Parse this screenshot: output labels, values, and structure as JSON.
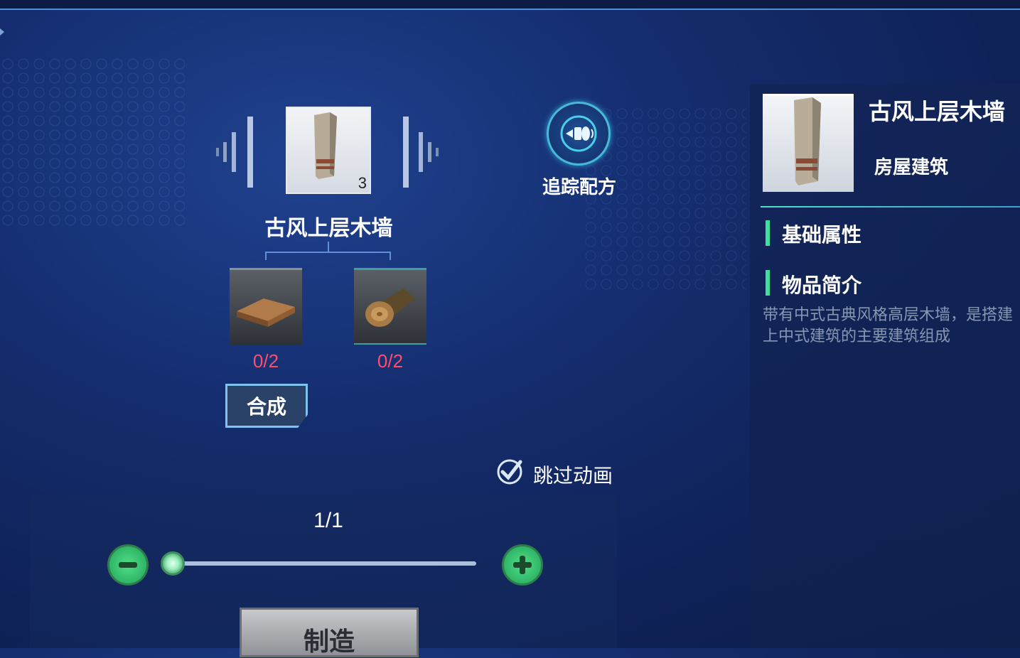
{
  "product": {
    "name": "古风上层木墙",
    "count": "3"
  },
  "materials": [
    {
      "name": "wood-plank",
      "progress": "0/2"
    },
    {
      "name": "wood-log",
      "progress": "0/2"
    }
  ],
  "buttons": {
    "synthesize": "合成",
    "track_recipe": "追踪配方",
    "make": "制造"
  },
  "skip_animation": {
    "label": "跳过动画",
    "checked": true
  },
  "quantity": {
    "ratio": "1/1",
    "current": 1,
    "max": 1
  },
  "info_panel": {
    "name": "古风上层木墙",
    "category": "房屋建筑",
    "sections": {
      "basic_attributes": "基础属性",
      "description_title": "物品简介"
    },
    "description_line1": "带有中式古典风格高层木墙，是搭建",
    "description_line2": "上中式建筑的主要建筑组成"
  },
  "colors": {
    "accent_green": "#3fe09a",
    "insufficient_red": "#ff4d6a",
    "highlight_cyan": "#49b9d8"
  }
}
